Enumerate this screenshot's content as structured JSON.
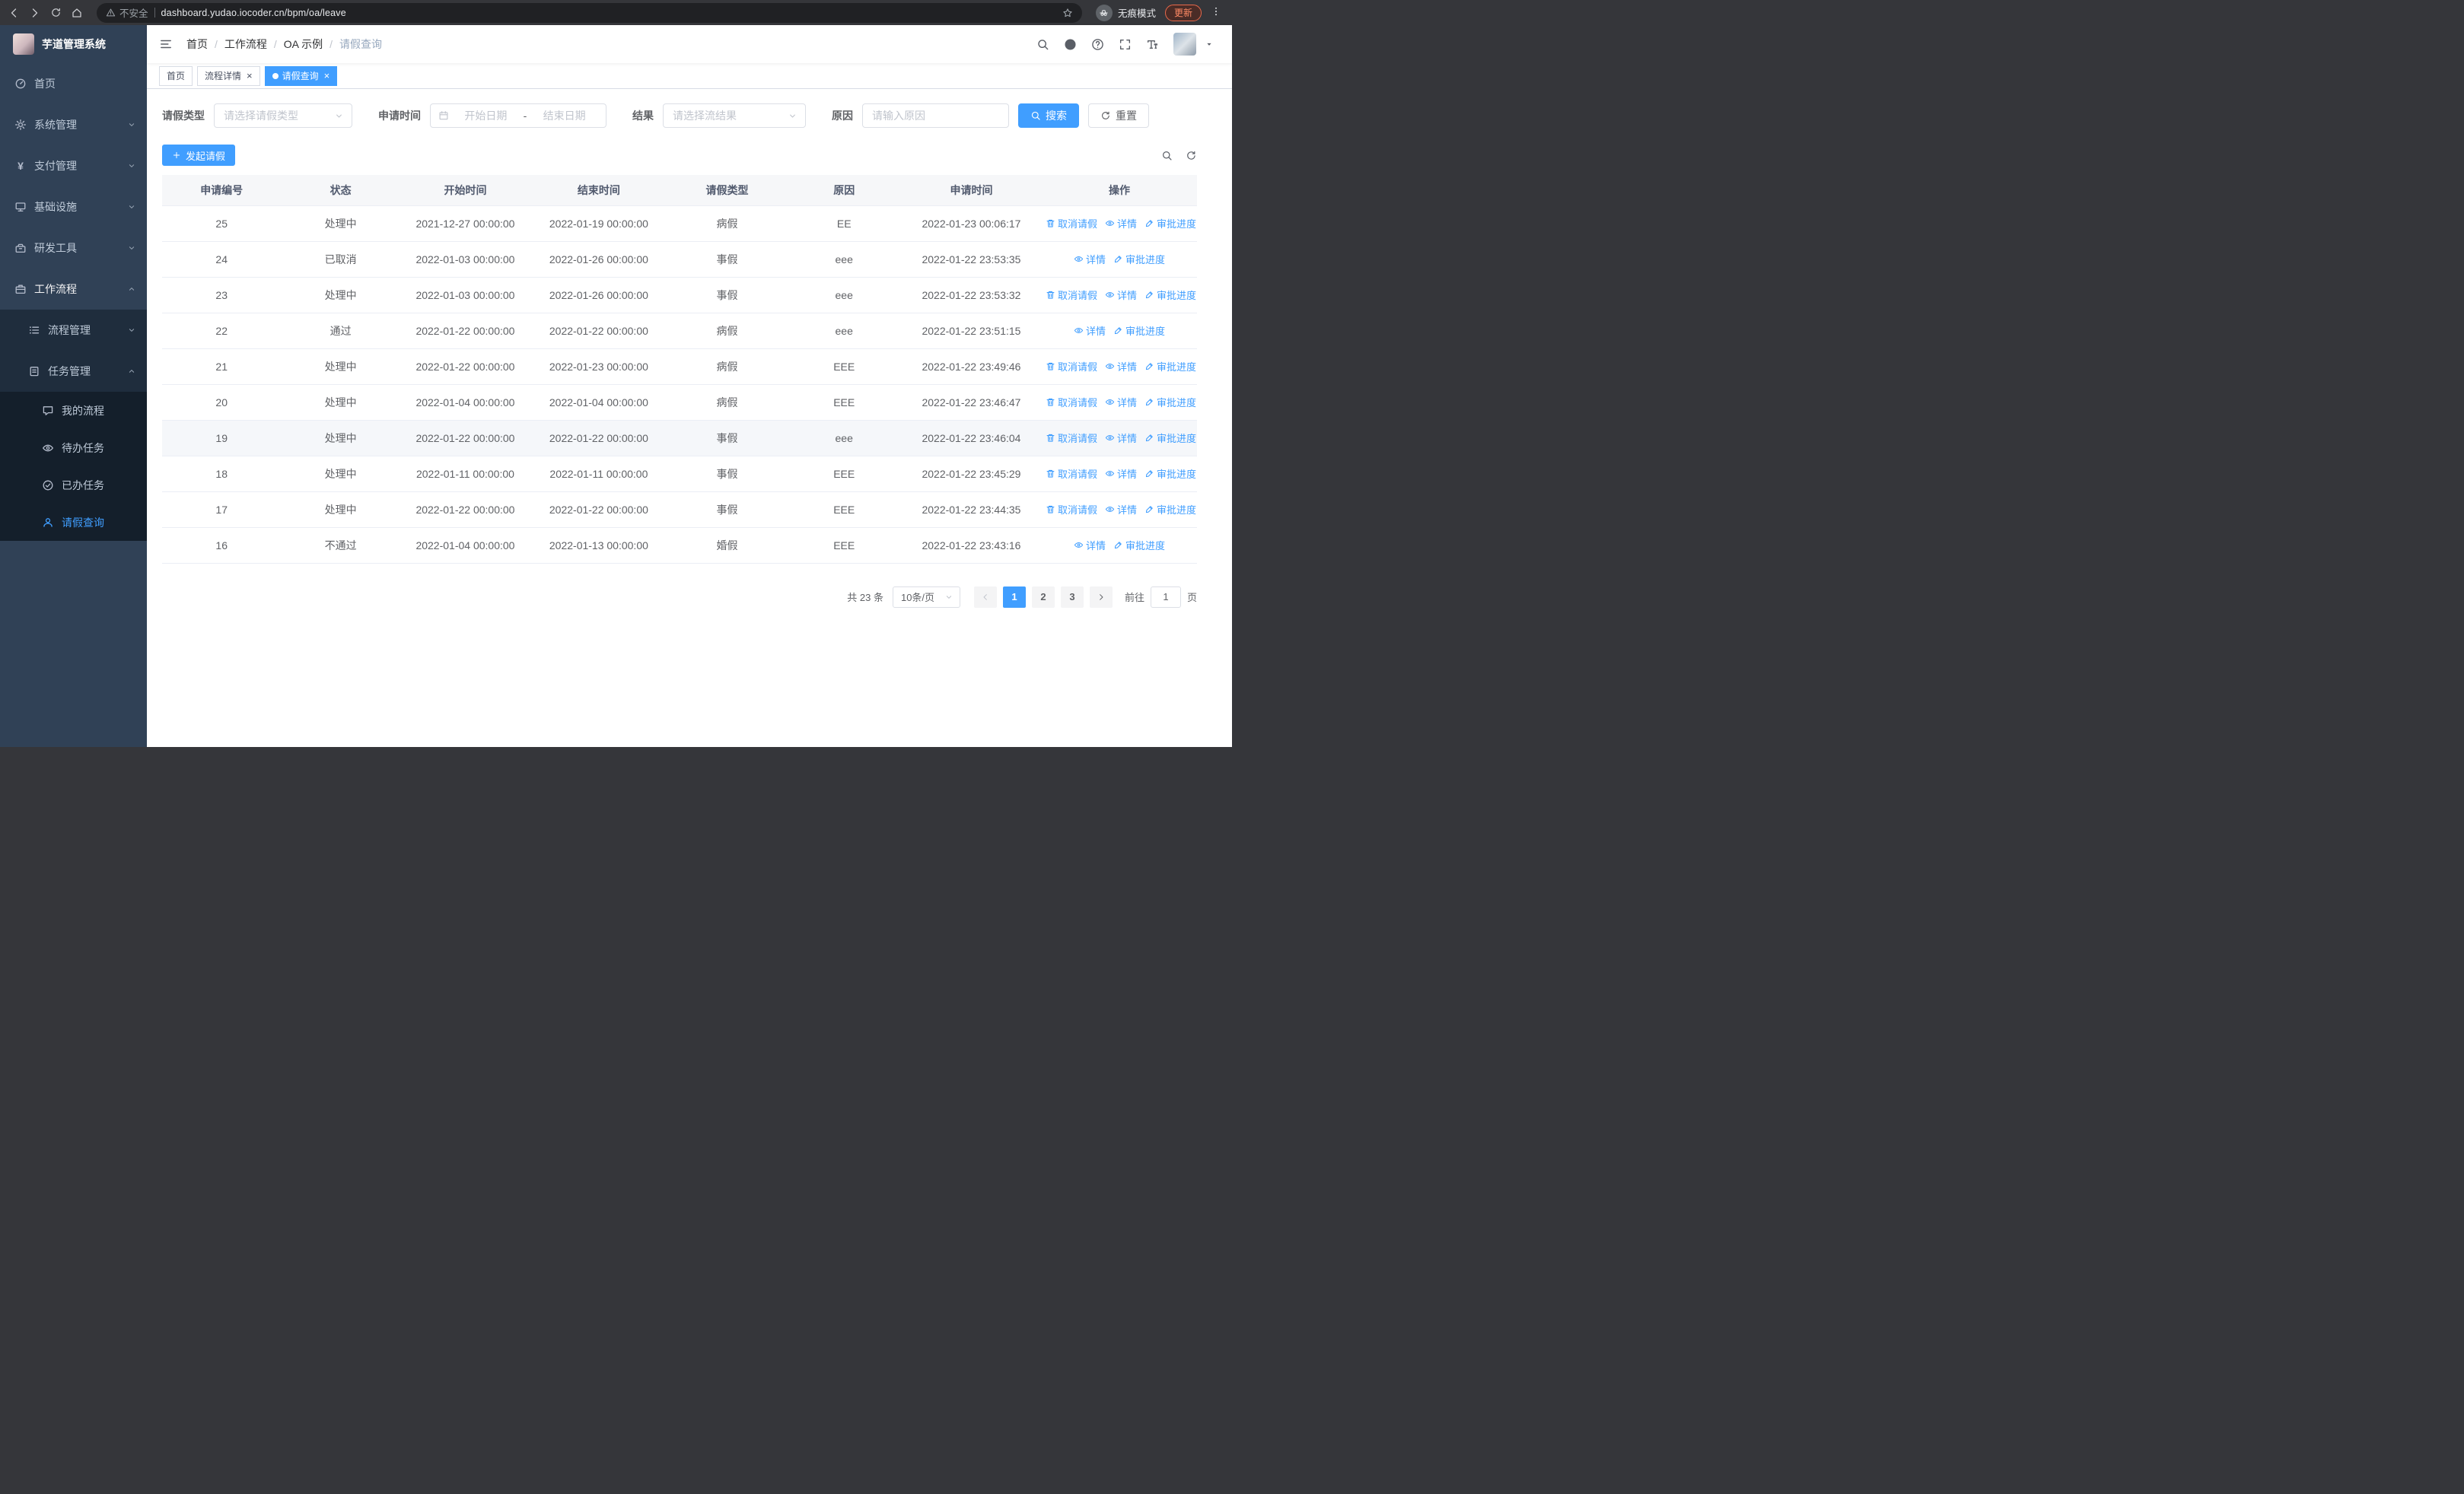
{
  "browser": {
    "security_label": "不安全",
    "url": "dashboard.yudao.iocoder.cn/bpm/oa/leave",
    "incognito_label": "无痕模式",
    "update_label": "更新"
  },
  "sidebar": {
    "title": "芋道管理系统",
    "items": [
      {
        "key": "home",
        "label": "首页",
        "icon": "dashboard-icon",
        "level": 1
      },
      {
        "key": "system-management",
        "label": "系统管理",
        "icon": "gear-icon",
        "level": 1,
        "chevron": "down"
      },
      {
        "key": "payment-management",
        "label": "支付管理",
        "icon": "yen-icon",
        "level": 1,
        "chevron": "down"
      },
      {
        "key": "infrastructure",
        "label": "基础设施",
        "icon": "monitor-icon",
        "level": 1,
        "chevron": "down"
      },
      {
        "key": "dev-tools",
        "label": "研发工具",
        "icon": "toolbox-icon",
        "level": 1,
        "chevron": "down"
      },
      {
        "key": "workflow",
        "label": "工作流程",
        "icon": "briefcase-icon",
        "level": 1,
        "chevron": "up",
        "open": true
      },
      {
        "key": "process-management",
        "label": "流程管理",
        "icon": "list-icon",
        "level": 2,
        "chevron": "down"
      },
      {
        "key": "task-management",
        "label": "任务管理",
        "icon": "clipboard-icon",
        "level": 2,
        "chevron": "up"
      },
      {
        "key": "my-process",
        "label": "我的流程",
        "icon": "chat-icon",
        "level": 3
      },
      {
        "key": "todo-tasks",
        "label": "待办任务",
        "icon": "eye-icon",
        "level": 3
      },
      {
        "key": "done-tasks",
        "label": "已办任务",
        "icon": "check-icon",
        "level": 3
      },
      {
        "key": "leave-query",
        "label": "请假查询",
        "icon": "user-icon",
        "level": 3,
        "active": true
      }
    ]
  },
  "header": {
    "breadcrumb": [
      "首页",
      "工作流程",
      "OA 示例",
      "请假查询"
    ]
  },
  "tabs": [
    {
      "key": "home",
      "label": "首页",
      "closable": false,
      "active": false
    },
    {
      "key": "process-detail",
      "label": "流程详情",
      "closable": true,
      "active": false
    },
    {
      "key": "leave-query",
      "label": "请假查询",
      "closable": true,
      "active": true
    }
  ],
  "filters": {
    "leave_type_label": "请假类型",
    "leave_type_placeholder": "请选择请假类型",
    "apply_time_label": "申请时间",
    "start_date_placeholder": "开始日期",
    "range_separator": "-",
    "end_date_placeholder": "结束日期",
    "result_label": "结果",
    "result_placeholder": "请选择流结果",
    "reason_label": "原因",
    "reason_placeholder": "请输入原因",
    "search_label": "搜索",
    "reset_label": "重置"
  },
  "toolbar": {
    "create_label": "发起请假"
  },
  "table": {
    "columns": [
      "申请编号",
      "状态",
      "开始时间",
      "结束时间",
      "请假类型",
      "原因",
      "申请时间",
      "操作"
    ],
    "ops_labels": {
      "cancel": "取消请假",
      "detail": "详情",
      "progress": "审批进度"
    },
    "rows": [
      {
        "id": "25",
        "status": "处理中",
        "start": "2021-12-27 00:00:00",
        "end": "2022-01-19 00:00:00",
        "type": "病假",
        "reason": "EE",
        "applied": "2022-01-23 00:06:17",
        "ops": [
          "cancel",
          "detail",
          "progress"
        ]
      },
      {
        "id": "24",
        "status": "已取消",
        "start": "2022-01-03 00:00:00",
        "end": "2022-01-26 00:00:00",
        "type": "事假",
        "reason": "eee",
        "applied": "2022-01-22 23:53:35",
        "ops": [
          "detail",
          "progress"
        ]
      },
      {
        "id": "23",
        "status": "处理中",
        "start": "2022-01-03 00:00:00",
        "end": "2022-01-26 00:00:00",
        "type": "事假",
        "reason": "eee",
        "applied": "2022-01-22 23:53:32",
        "ops": [
          "cancel",
          "detail",
          "progress"
        ]
      },
      {
        "id": "22",
        "status": "通过",
        "start": "2022-01-22 00:00:00",
        "end": "2022-01-22 00:00:00",
        "type": "病假",
        "reason": "eee",
        "applied": "2022-01-22 23:51:15",
        "ops": [
          "detail",
          "progress"
        ]
      },
      {
        "id": "21",
        "status": "处理中",
        "start": "2022-01-22 00:00:00",
        "end": "2022-01-23 00:00:00",
        "type": "病假",
        "reason": "EEE",
        "applied": "2022-01-22 23:49:46",
        "ops": [
          "cancel",
          "detail",
          "progress"
        ]
      },
      {
        "id": "20",
        "status": "处理中",
        "start": "2022-01-04 00:00:00",
        "end": "2022-01-04 00:00:00",
        "type": "病假",
        "reason": "EEE",
        "applied": "2022-01-22 23:46:47",
        "ops": [
          "cancel",
          "detail",
          "progress"
        ]
      },
      {
        "id": "19",
        "status": "处理中",
        "start": "2022-01-22 00:00:00",
        "end": "2022-01-22 00:00:00",
        "type": "事假",
        "reason": "eee",
        "applied": "2022-01-22 23:46:04",
        "ops": [
          "cancel",
          "detail",
          "progress"
        ],
        "highlight": true
      },
      {
        "id": "18",
        "status": "处理中",
        "start": "2022-01-11 00:00:00",
        "end": "2022-01-11 00:00:00",
        "type": "事假",
        "reason": "EEE",
        "applied": "2022-01-22 23:45:29",
        "ops": [
          "cancel",
          "detail",
          "progress"
        ]
      },
      {
        "id": "17",
        "status": "处理中",
        "start": "2022-01-22 00:00:00",
        "end": "2022-01-22 00:00:00",
        "type": "事假",
        "reason": "EEE",
        "applied": "2022-01-22 23:44:35",
        "ops": [
          "cancel",
          "detail",
          "progress"
        ]
      },
      {
        "id": "16",
        "status": "不通过",
        "start": "2022-01-04 00:00:00",
        "end": "2022-01-13 00:00:00",
        "type": "婚假",
        "reason": "EEE",
        "applied": "2022-01-22 23:43:16",
        "ops": [
          "detail",
          "progress"
        ]
      }
    ]
  },
  "pagination": {
    "total_label": "共 23 条",
    "page_size": "10条/页",
    "pages": [
      "1",
      "2",
      "3"
    ],
    "active_page": "1",
    "goto_prefix": "前往",
    "goto_value": "1",
    "goto_suffix": "页"
  }
}
